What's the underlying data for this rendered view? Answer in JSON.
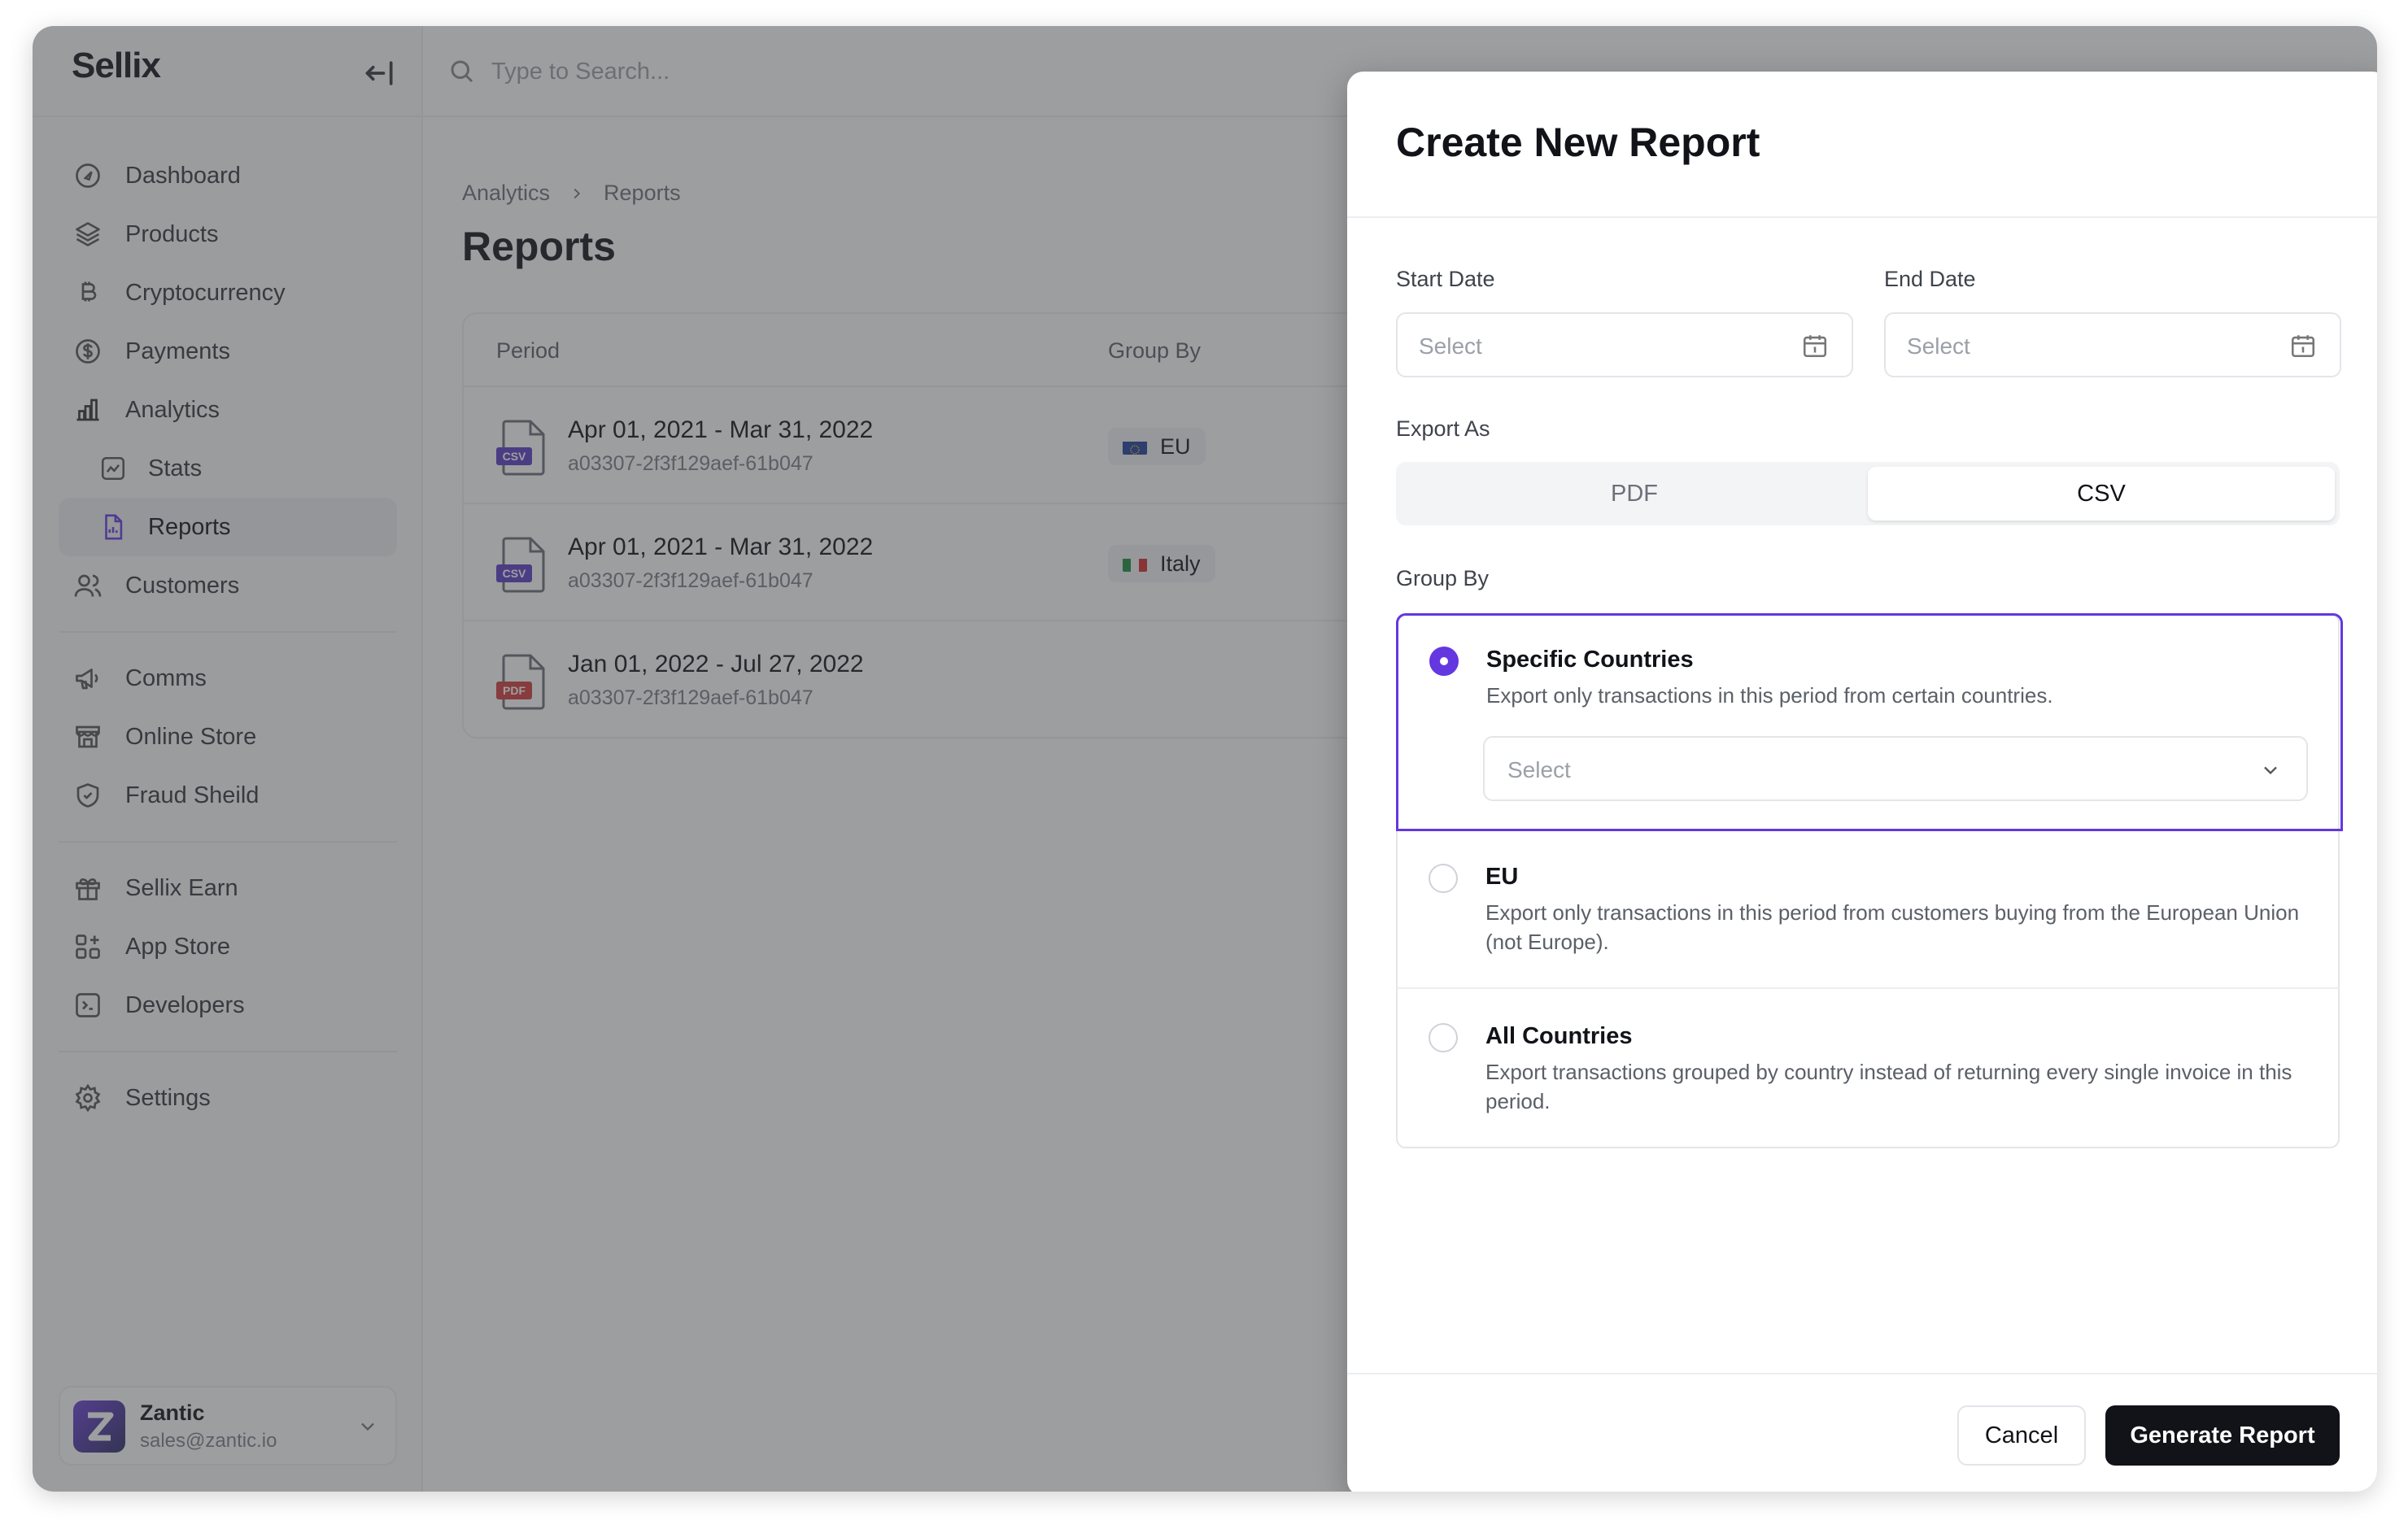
{
  "app": {
    "logo": "Sellix"
  },
  "search": {
    "placeholder": "Type to Search..."
  },
  "sidebar": {
    "items": [
      {
        "label": "Dashboard",
        "icon": "dashboard-icon"
      },
      {
        "label": "Products",
        "icon": "layers-icon"
      },
      {
        "label": "Cryptocurrency",
        "icon": "bitcoin-icon"
      },
      {
        "label": "Payments",
        "icon": "dollar-icon"
      },
      {
        "label": "Analytics",
        "icon": "bar-chart-icon"
      },
      {
        "label": "Stats",
        "icon": "stats-icon"
      },
      {
        "label": "Reports",
        "icon": "report-icon"
      },
      {
        "label": "Customers",
        "icon": "users-icon"
      },
      {
        "label": "Comms",
        "icon": "megaphone-icon"
      },
      {
        "label": "Online Store",
        "icon": "store-icon"
      },
      {
        "label": "Fraud Sheild",
        "icon": "shield-icon"
      },
      {
        "label": "Sellix Earn",
        "icon": "gift-icon"
      },
      {
        "label": "App Store",
        "icon": "apps-icon"
      },
      {
        "label": "Developers",
        "icon": "terminal-icon"
      },
      {
        "label": "Settings",
        "icon": "gear-icon"
      }
    ],
    "user": {
      "name": "Zantic",
      "email": "sales@zantic.io"
    }
  },
  "main": {
    "breadcrumb": [
      "Analytics",
      "Reports"
    ],
    "title": "Reports",
    "table": {
      "columns": [
        "Period",
        "Group By"
      ],
      "rows": [
        {
          "type": "CSV",
          "period": "Apr 01, 2021 - Mar 31, 2022",
          "id": "a03307-2f3f129aef-61b047",
          "group": "EU"
        },
        {
          "type": "CSV",
          "period": "Apr 01, 2021 - Mar 31, 2022",
          "id": "a03307-2f3f129aef-61b047",
          "group": "Italy"
        },
        {
          "type": "PDF",
          "period": "Jan 01, 2022 - Jul 27, 2022",
          "id": "a03307-2f3f129aef-61b047",
          "group": ""
        }
      ]
    }
  },
  "modal": {
    "title": "Create New Report",
    "start_date_label": "Start Date",
    "end_date_label": "End Date",
    "date_placeholder": "Select",
    "export_label": "Export As",
    "export_options": [
      "PDF",
      "CSV"
    ],
    "export_selected": "CSV",
    "group_label": "Group By",
    "group_options": [
      {
        "title": "Specific Countries",
        "desc": "Export only transactions in this period from certain countries.",
        "selected": true
      },
      {
        "title": "EU",
        "desc": "Export only transactions in this period from customers buying from the European Union (not Europe).",
        "selected": false
      },
      {
        "title": "All Countries",
        "desc": "Export transactions grouped by country instead of returning every single invoice in this period.",
        "selected": false
      }
    ],
    "country_placeholder": "Select",
    "cancel_label": "Cancel",
    "submit_label": "Generate Report"
  },
  "colors": {
    "accent": "#6437e0",
    "primary_button": "#111318",
    "csv_badge": "#5b3cc4",
    "pdf_badge": "#d33a3a"
  }
}
